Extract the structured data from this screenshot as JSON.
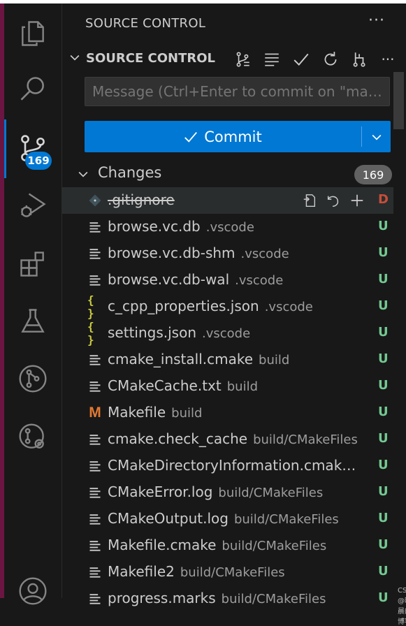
{
  "activity_bar": {
    "items": [
      {
        "name": "explorer",
        "icon": "files-icon"
      },
      {
        "name": "search",
        "icon": "search-icon"
      },
      {
        "name": "source-control",
        "icon": "source-control-icon",
        "badge": "169",
        "active": true
      },
      {
        "name": "run-and-debug",
        "icon": "run-debug-icon"
      },
      {
        "name": "extensions",
        "icon": "extensions-icon"
      },
      {
        "name": "testing",
        "icon": "beaker-icon"
      },
      {
        "name": "git-graph",
        "icon": "git-graph-icon"
      },
      {
        "name": "remote",
        "icon": "remote-icon"
      },
      {
        "name": "accounts",
        "icon": "account-icon"
      }
    ],
    "active_color": "#0078d4"
  },
  "panel": {
    "title": "SOURCE CONTROL",
    "more": "···"
  },
  "section": {
    "title": "SOURCE CONTROL",
    "tools": [
      "view-graph-icon",
      "list-icon",
      "check-icon",
      "refresh-icon",
      "branch-icon",
      "more-icon"
    ],
    "more": "···"
  },
  "commit": {
    "placeholder": "Message (Ctrl+Enter to commit on \"ma…",
    "button_label": "Commit"
  },
  "changes": {
    "label": "Changes",
    "count": "169",
    "files": [
      {
        "icon": "git-icon",
        "name": ".gitignore",
        "dir": "",
        "status": "D",
        "deleted": true
      },
      {
        "icon": "file-lines-icon",
        "name": "browse.vc.db",
        "dir": ".vscode",
        "status": "U"
      },
      {
        "icon": "file-lines-icon",
        "name": "browse.vc.db-shm",
        "dir": ".vscode",
        "status": "U"
      },
      {
        "icon": "file-lines-icon",
        "name": "browse.vc.db-wal",
        "dir": ".vscode",
        "status": "U"
      },
      {
        "icon": "json-icon",
        "name": "c_cpp_properties.json",
        "dir": ".vscode",
        "status": "U"
      },
      {
        "icon": "json-icon",
        "name": "settings.json",
        "dir": ".vscode",
        "status": "U"
      },
      {
        "icon": "file-lines-icon",
        "name": "cmake_install.cmake",
        "dir": "build",
        "status": "U"
      },
      {
        "icon": "file-lines-icon",
        "name": "CMakeCache.txt",
        "dir": "build",
        "status": "U"
      },
      {
        "icon": "makefile-icon",
        "name": "Makefile",
        "dir": "build",
        "status": "U"
      },
      {
        "icon": "file-lines-icon",
        "name": "cmake.check_cache",
        "dir": "build/CMakeFiles",
        "status": "U"
      },
      {
        "icon": "file-lines-icon",
        "name": "CMakeDirectoryInformation.cmak…",
        "dir": "",
        "status": "U"
      },
      {
        "icon": "file-lines-icon",
        "name": "CMakeError.log",
        "dir": "build/CMakeFiles",
        "status": "U"
      },
      {
        "icon": "file-lines-icon",
        "name": "CMakeOutput.log",
        "dir": "build/CMakeFiles",
        "status": "U"
      },
      {
        "icon": "file-lines-icon",
        "name": "Makefile.cmake",
        "dir": "build/CMakeFiles",
        "status": "U"
      },
      {
        "icon": "file-lines-icon",
        "name": "Makefile2",
        "dir": "build/CMakeFiles",
        "status": "U"
      },
      {
        "icon": "file-lines-icon",
        "name": "progress.marks",
        "dir": "build/CMakeFiles",
        "status": "U"
      }
    ],
    "row_actions": [
      "open-file-icon",
      "discard-icon",
      "stage-icon"
    ]
  },
  "colors": {
    "untracked": "#73c991",
    "deleted": "#c74e39",
    "json_icon": "#cbcb41",
    "makefile_icon": "#e37933",
    "accent": "#0078d4"
  },
  "watermark": "CSDN @晓晨的博客"
}
